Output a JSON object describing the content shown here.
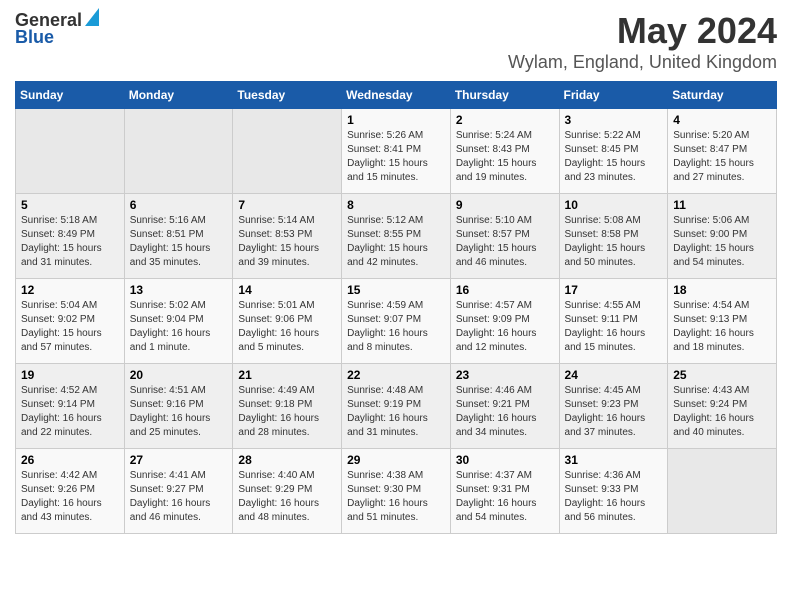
{
  "header": {
    "logo_general": "General",
    "logo_blue": "Blue",
    "month_title": "May 2024",
    "location": "Wylam, England, United Kingdom"
  },
  "weekdays": [
    "Sunday",
    "Monday",
    "Tuesday",
    "Wednesday",
    "Thursday",
    "Friday",
    "Saturday"
  ],
  "weeks": [
    [
      {
        "day": "",
        "empty": true
      },
      {
        "day": "",
        "empty": true
      },
      {
        "day": "",
        "empty": true
      },
      {
        "day": "1",
        "sunrise": "5:26 AM",
        "sunset": "8:41 PM",
        "daylight": "15 hours and 15 minutes."
      },
      {
        "day": "2",
        "sunrise": "5:24 AM",
        "sunset": "8:43 PM",
        "daylight": "15 hours and 19 minutes."
      },
      {
        "day": "3",
        "sunrise": "5:22 AM",
        "sunset": "8:45 PM",
        "daylight": "15 hours and 23 minutes."
      },
      {
        "day": "4",
        "sunrise": "5:20 AM",
        "sunset": "8:47 PM",
        "daylight": "15 hours and 27 minutes."
      }
    ],
    [
      {
        "day": "5",
        "sunrise": "5:18 AM",
        "sunset": "8:49 PM",
        "daylight": "15 hours and 31 minutes."
      },
      {
        "day": "6",
        "sunrise": "5:16 AM",
        "sunset": "8:51 PM",
        "daylight": "15 hours and 35 minutes."
      },
      {
        "day": "7",
        "sunrise": "5:14 AM",
        "sunset": "8:53 PM",
        "daylight": "15 hours and 39 minutes."
      },
      {
        "day": "8",
        "sunrise": "5:12 AM",
        "sunset": "8:55 PM",
        "daylight": "15 hours and 42 minutes."
      },
      {
        "day": "9",
        "sunrise": "5:10 AM",
        "sunset": "8:57 PM",
        "daylight": "15 hours and 46 minutes."
      },
      {
        "day": "10",
        "sunrise": "5:08 AM",
        "sunset": "8:58 PM",
        "daylight": "15 hours and 50 minutes."
      },
      {
        "day": "11",
        "sunrise": "5:06 AM",
        "sunset": "9:00 PM",
        "daylight": "15 hours and 54 minutes."
      }
    ],
    [
      {
        "day": "12",
        "sunrise": "5:04 AM",
        "sunset": "9:02 PM",
        "daylight": "15 hours and 57 minutes."
      },
      {
        "day": "13",
        "sunrise": "5:02 AM",
        "sunset": "9:04 PM",
        "daylight": "16 hours and 1 minute."
      },
      {
        "day": "14",
        "sunrise": "5:01 AM",
        "sunset": "9:06 PM",
        "daylight": "16 hours and 5 minutes."
      },
      {
        "day": "15",
        "sunrise": "4:59 AM",
        "sunset": "9:07 PM",
        "daylight": "16 hours and 8 minutes."
      },
      {
        "day": "16",
        "sunrise": "4:57 AM",
        "sunset": "9:09 PM",
        "daylight": "16 hours and 12 minutes."
      },
      {
        "day": "17",
        "sunrise": "4:55 AM",
        "sunset": "9:11 PM",
        "daylight": "16 hours and 15 minutes."
      },
      {
        "day": "18",
        "sunrise": "4:54 AM",
        "sunset": "9:13 PM",
        "daylight": "16 hours and 18 minutes."
      }
    ],
    [
      {
        "day": "19",
        "sunrise": "4:52 AM",
        "sunset": "9:14 PM",
        "daylight": "16 hours and 22 minutes."
      },
      {
        "day": "20",
        "sunrise": "4:51 AM",
        "sunset": "9:16 PM",
        "daylight": "16 hours and 25 minutes."
      },
      {
        "day": "21",
        "sunrise": "4:49 AM",
        "sunset": "9:18 PM",
        "daylight": "16 hours and 28 minutes."
      },
      {
        "day": "22",
        "sunrise": "4:48 AM",
        "sunset": "9:19 PM",
        "daylight": "16 hours and 31 minutes."
      },
      {
        "day": "23",
        "sunrise": "4:46 AM",
        "sunset": "9:21 PM",
        "daylight": "16 hours and 34 minutes."
      },
      {
        "day": "24",
        "sunrise": "4:45 AM",
        "sunset": "9:23 PM",
        "daylight": "16 hours and 37 minutes."
      },
      {
        "day": "25",
        "sunrise": "4:43 AM",
        "sunset": "9:24 PM",
        "daylight": "16 hours and 40 minutes."
      }
    ],
    [
      {
        "day": "26",
        "sunrise": "4:42 AM",
        "sunset": "9:26 PM",
        "daylight": "16 hours and 43 minutes."
      },
      {
        "day": "27",
        "sunrise": "4:41 AM",
        "sunset": "9:27 PM",
        "daylight": "16 hours and 46 minutes."
      },
      {
        "day": "28",
        "sunrise": "4:40 AM",
        "sunset": "9:29 PM",
        "daylight": "16 hours and 48 minutes."
      },
      {
        "day": "29",
        "sunrise": "4:38 AM",
        "sunset": "9:30 PM",
        "daylight": "16 hours and 51 minutes."
      },
      {
        "day": "30",
        "sunrise": "4:37 AM",
        "sunset": "9:31 PM",
        "daylight": "16 hours and 54 minutes."
      },
      {
        "day": "31",
        "sunrise": "4:36 AM",
        "sunset": "9:33 PM",
        "daylight": "16 hours and 56 minutes."
      },
      {
        "day": "",
        "empty": true
      }
    ]
  ],
  "labels": {
    "sunrise_prefix": "Sunrise: ",
    "sunset_prefix": "Sunset: ",
    "daylight_prefix": "Daylight: "
  }
}
